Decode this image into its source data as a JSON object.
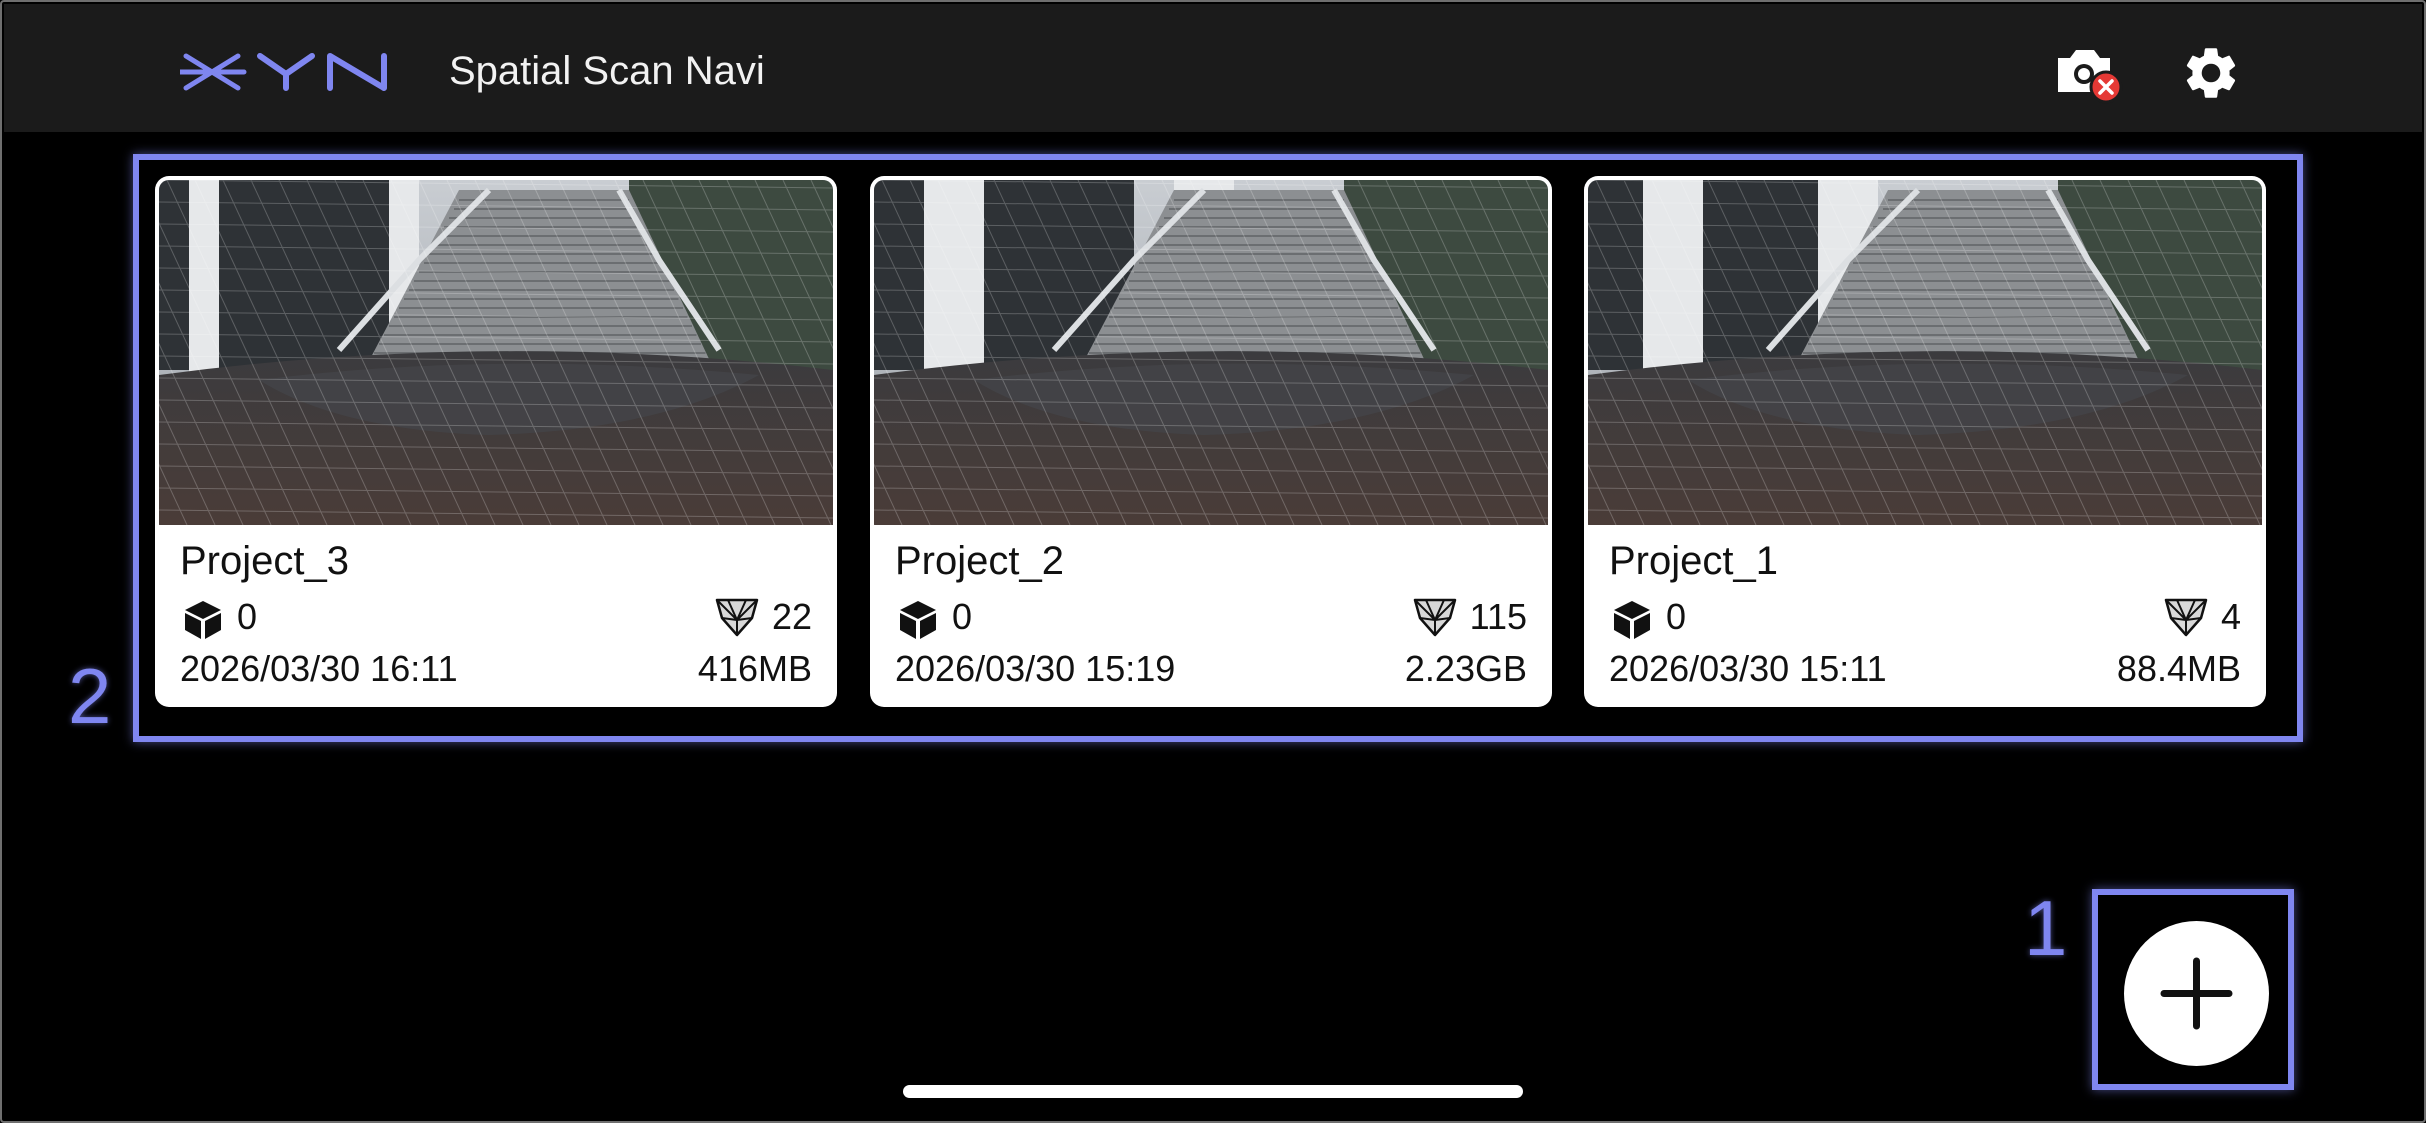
{
  "header": {
    "logo_text": "XYN",
    "title": "Spatial Scan Navi",
    "camera_status_icon": "camera-off-icon",
    "settings_icon": "gear-icon"
  },
  "projects": [
    {
      "name": "Project_3",
      "object_count": "0",
      "anchor_count": "22",
      "date": "2026/03/30 16:11",
      "size": "416MB"
    },
    {
      "name": "Project_2",
      "object_count": "0",
      "anchor_count": "115",
      "date": "2026/03/30 15:19",
      "size": "2.23GB"
    },
    {
      "name": "Project_1",
      "object_count": "0",
      "anchor_count": "4",
      "date": "2026/03/30 15:11",
      "size": "88.4MB"
    }
  ],
  "annotations": {
    "add_button_marker": "1",
    "project_list_marker": "2"
  },
  "add_button": {
    "icon": "plus-icon"
  },
  "colors": {
    "accent": "#7f86f0",
    "header_bg": "#1b1b1b",
    "background": "#000000",
    "camera_error": "#e53935"
  }
}
